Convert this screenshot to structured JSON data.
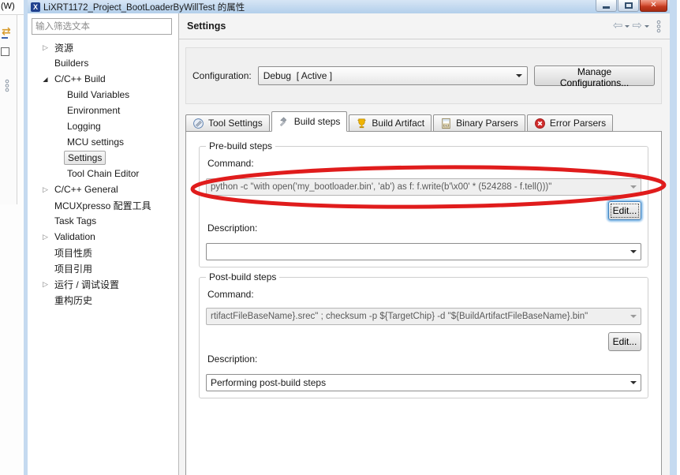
{
  "background": {
    "menu_text": "(W)"
  },
  "window": {
    "title": "LiXRT1172_Project_BootLoaderByWillTest 的属性"
  },
  "sidebar": {
    "filter_placeholder": "输入筛选文本",
    "tree": [
      {
        "label": "资源"
      },
      {
        "label": "Builders"
      },
      {
        "label": "C/C++ Build"
      },
      {
        "label": "Build Variables"
      },
      {
        "label": "Environment"
      },
      {
        "label": "Logging"
      },
      {
        "label": "MCU settings"
      },
      {
        "label": "Settings"
      },
      {
        "label": "Tool Chain Editor"
      },
      {
        "label": "C/C++ General"
      },
      {
        "label": "MCUXpresso 配置工具"
      },
      {
        "label": "Task Tags"
      },
      {
        "label": "Validation"
      },
      {
        "label": "项目性质"
      },
      {
        "label": "项目引用"
      },
      {
        "label": "运行 / 调试设置"
      },
      {
        "label": "重构历史"
      }
    ]
  },
  "header": {
    "title": "Settings"
  },
  "configuration": {
    "label": "Configuration:",
    "value": "Debug  [ Active ]",
    "manage_button": "Manage Configurations..."
  },
  "tabs": [
    {
      "label": "Tool Settings"
    },
    {
      "label": "Build steps"
    },
    {
      "label": "Build Artifact"
    },
    {
      "label": "Binary Parsers"
    },
    {
      "label": "Error Parsers"
    }
  ],
  "pre_build": {
    "group_title": "Pre-build steps",
    "command_label": "Command:",
    "command_value": "python -c \"with open('my_bootloader.bin', 'ab') as f: f.write(b'\\x00' * (524288 - f.tell()))\"",
    "edit_button": "Edit...",
    "description_label": "Description:",
    "description_value": ""
  },
  "post_build": {
    "group_title": "Post-build steps",
    "command_label": "Command:",
    "command_value": "rtifactFileBaseName}.srec\" ; checksum -p ${TargetChip} -d \"${BuildArtifactFileBaseName}.bin\"",
    "edit_button": "Edit...",
    "description_label": "Description:",
    "description_value": "Performing post-build steps"
  },
  "annotation": {
    "color": "#e01c1c"
  }
}
